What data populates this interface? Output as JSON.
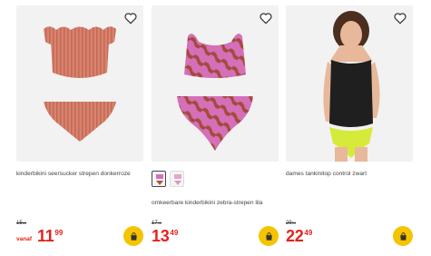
{
  "colors": {
    "price_red": "#e2231a",
    "cart_yellow": "#f5c400"
  },
  "products": [
    {
      "title": "kinderbikini seersucker strepen donkerroze",
      "old_price_main": "15",
      "old_price_sup": "00",
      "prefix": "vanaf",
      "price_int": "11",
      "price_dec": "99",
      "favorite_icon": "heart-outline-icon",
      "cart_icon": "shopping-bag-icon"
    },
    {
      "title": "omkeerbare kinderbikini zebra-strepen lila",
      "old_price_main": "17",
      "old_price_sup": "99",
      "price_int": "13",
      "price_dec": "49",
      "favorite_icon": "heart-outline-icon",
      "cart_icon": "shopping-bag-icon",
      "swatches": [
        "zebra-pink-variant",
        "zebra-lila-variant"
      ]
    },
    {
      "title": "dames tankinitop control zwart",
      "old_price_main": "29",
      "old_price_sup": "99",
      "price_int": "22",
      "price_dec": "49",
      "favorite_icon": "heart-outline-icon",
      "cart_icon": "shopping-bag-icon"
    }
  ]
}
